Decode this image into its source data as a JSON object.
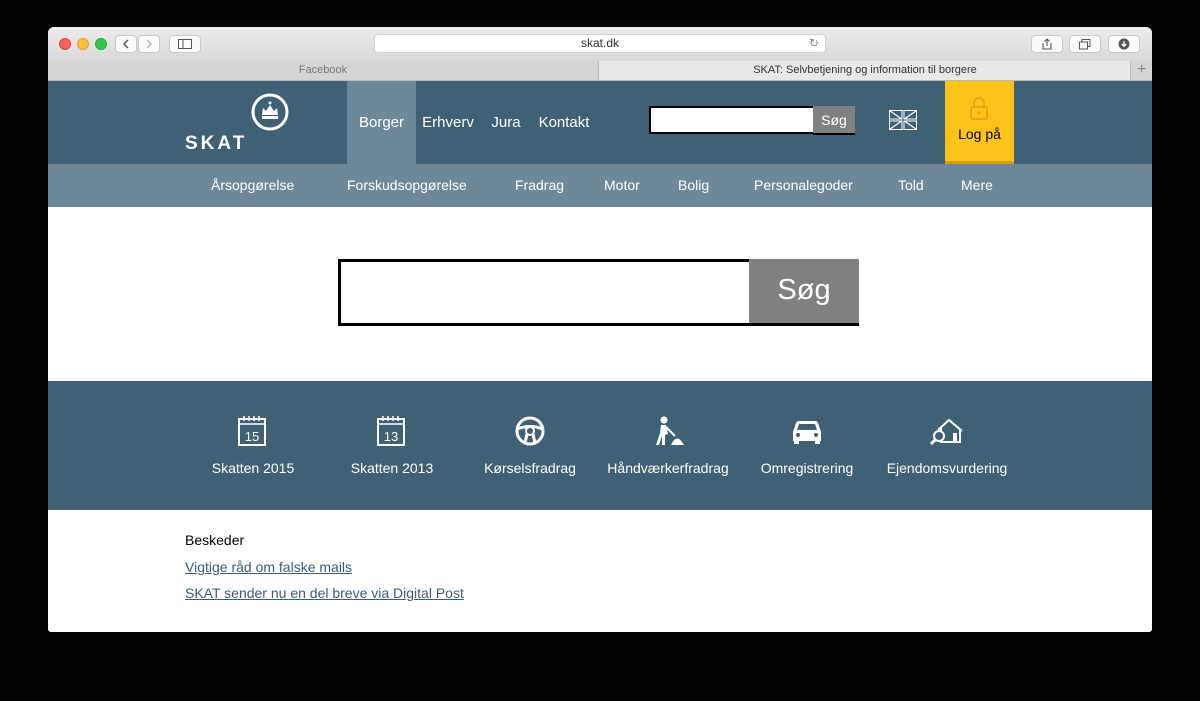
{
  "browser": {
    "url": "skat.dk",
    "tabs": [
      {
        "label": "Facebook"
      },
      {
        "label": "SKAT: Selvbetjening og information til borgere"
      }
    ],
    "new_tab_label": "+"
  },
  "header": {
    "logo_text": "SKAT",
    "nav": [
      {
        "label": "Borger",
        "active": true
      },
      {
        "label": "Erhverv"
      },
      {
        "label": "Jura"
      },
      {
        "label": "Kontakt"
      }
    ],
    "search_button": "Søg",
    "language_icon": "uk-flag-icon",
    "login_label": "Log på",
    "login_icon": "lock-icon"
  },
  "subnav": [
    "Årsopgørelse",
    "Forskudsopgørelse",
    "Fradrag",
    "Motor",
    "Bolig",
    "Personalegoder",
    "Told",
    "Mere"
  ],
  "main_search": {
    "button": "Søg",
    "value": ""
  },
  "quick_links": [
    {
      "label": "Skatten 2015",
      "icon": "calendar-15-icon",
      "icon_text": "15"
    },
    {
      "label": "Skatten 2013",
      "icon": "calendar-13-icon",
      "icon_text": "13"
    },
    {
      "label": "Kørselsfradrag",
      "icon": "steering-wheel-icon"
    },
    {
      "label": "Håndværkerfradrag",
      "icon": "worker-icon"
    },
    {
      "label": "Omregistrering",
      "icon": "car-icon"
    },
    {
      "label": "Ejendomsvurdering",
      "icon": "house-magnifier-icon"
    }
  ],
  "messages": {
    "title": "Beskeder",
    "links": [
      "Vigtige råd om falske mails",
      "SKAT sender nu en del breve via Digital Post"
    ]
  },
  "colors": {
    "header_bg": "#3f6075",
    "subnav_bg": "#6d8898",
    "login_bg": "#fec319",
    "link": "#3c5b78"
  }
}
